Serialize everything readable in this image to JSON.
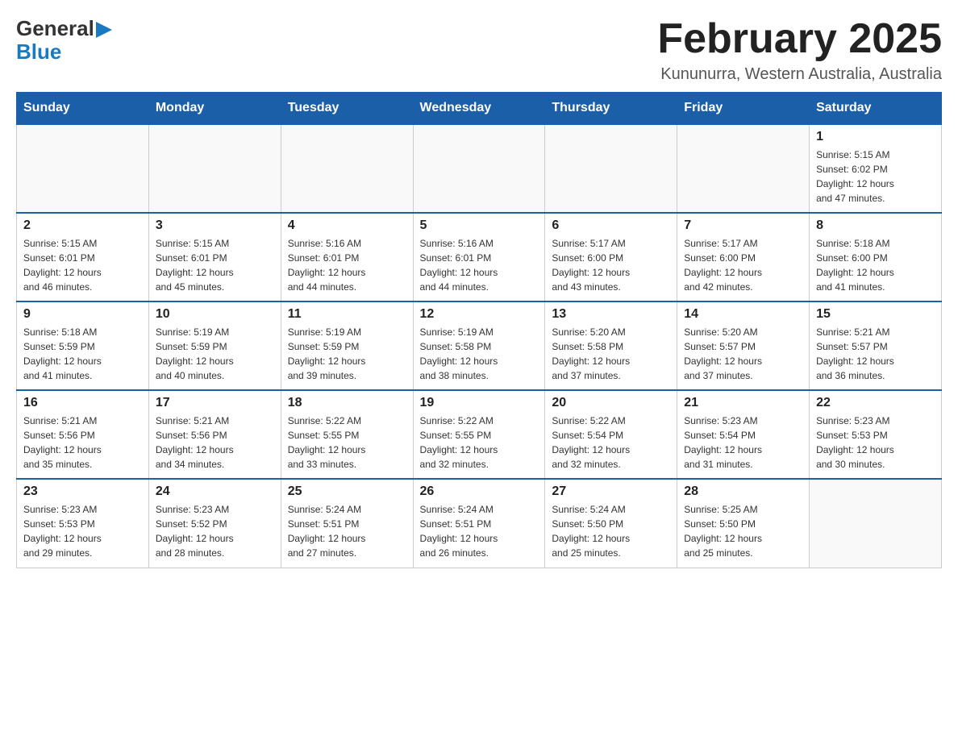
{
  "logo": {
    "line1": "General",
    "arrow": "▶",
    "line2": "Blue"
  },
  "title": "February 2025",
  "location": "Kununurra, Western Australia, Australia",
  "days_of_week": [
    "Sunday",
    "Monday",
    "Tuesday",
    "Wednesday",
    "Thursday",
    "Friday",
    "Saturday"
  ],
  "weeks": [
    [
      {
        "day": "",
        "info": ""
      },
      {
        "day": "",
        "info": ""
      },
      {
        "day": "",
        "info": ""
      },
      {
        "day": "",
        "info": ""
      },
      {
        "day": "",
        "info": ""
      },
      {
        "day": "",
        "info": ""
      },
      {
        "day": "1",
        "info": "Sunrise: 5:15 AM\nSunset: 6:02 PM\nDaylight: 12 hours\nand 47 minutes."
      }
    ],
    [
      {
        "day": "2",
        "info": "Sunrise: 5:15 AM\nSunset: 6:01 PM\nDaylight: 12 hours\nand 46 minutes."
      },
      {
        "day": "3",
        "info": "Sunrise: 5:15 AM\nSunset: 6:01 PM\nDaylight: 12 hours\nand 45 minutes."
      },
      {
        "day": "4",
        "info": "Sunrise: 5:16 AM\nSunset: 6:01 PM\nDaylight: 12 hours\nand 44 minutes."
      },
      {
        "day": "5",
        "info": "Sunrise: 5:16 AM\nSunset: 6:01 PM\nDaylight: 12 hours\nand 44 minutes."
      },
      {
        "day": "6",
        "info": "Sunrise: 5:17 AM\nSunset: 6:00 PM\nDaylight: 12 hours\nand 43 minutes."
      },
      {
        "day": "7",
        "info": "Sunrise: 5:17 AM\nSunset: 6:00 PM\nDaylight: 12 hours\nand 42 minutes."
      },
      {
        "day": "8",
        "info": "Sunrise: 5:18 AM\nSunset: 6:00 PM\nDaylight: 12 hours\nand 41 minutes."
      }
    ],
    [
      {
        "day": "9",
        "info": "Sunrise: 5:18 AM\nSunset: 5:59 PM\nDaylight: 12 hours\nand 41 minutes."
      },
      {
        "day": "10",
        "info": "Sunrise: 5:19 AM\nSunset: 5:59 PM\nDaylight: 12 hours\nand 40 minutes."
      },
      {
        "day": "11",
        "info": "Sunrise: 5:19 AM\nSunset: 5:59 PM\nDaylight: 12 hours\nand 39 minutes."
      },
      {
        "day": "12",
        "info": "Sunrise: 5:19 AM\nSunset: 5:58 PM\nDaylight: 12 hours\nand 38 minutes."
      },
      {
        "day": "13",
        "info": "Sunrise: 5:20 AM\nSunset: 5:58 PM\nDaylight: 12 hours\nand 37 minutes."
      },
      {
        "day": "14",
        "info": "Sunrise: 5:20 AM\nSunset: 5:57 PM\nDaylight: 12 hours\nand 37 minutes."
      },
      {
        "day": "15",
        "info": "Sunrise: 5:21 AM\nSunset: 5:57 PM\nDaylight: 12 hours\nand 36 minutes."
      }
    ],
    [
      {
        "day": "16",
        "info": "Sunrise: 5:21 AM\nSunset: 5:56 PM\nDaylight: 12 hours\nand 35 minutes."
      },
      {
        "day": "17",
        "info": "Sunrise: 5:21 AM\nSunset: 5:56 PM\nDaylight: 12 hours\nand 34 minutes."
      },
      {
        "day": "18",
        "info": "Sunrise: 5:22 AM\nSunset: 5:55 PM\nDaylight: 12 hours\nand 33 minutes."
      },
      {
        "day": "19",
        "info": "Sunrise: 5:22 AM\nSunset: 5:55 PM\nDaylight: 12 hours\nand 32 minutes."
      },
      {
        "day": "20",
        "info": "Sunrise: 5:22 AM\nSunset: 5:54 PM\nDaylight: 12 hours\nand 32 minutes."
      },
      {
        "day": "21",
        "info": "Sunrise: 5:23 AM\nSunset: 5:54 PM\nDaylight: 12 hours\nand 31 minutes."
      },
      {
        "day": "22",
        "info": "Sunrise: 5:23 AM\nSunset: 5:53 PM\nDaylight: 12 hours\nand 30 minutes."
      }
    ],
    [
      {
        "day": "23",
        "info": "Sunrise: 5:23 AM\nSunset: 5:53 PM\nDaylight: 12 hours\nand 29 minutes."
      },
      {
        "day": "24",
        "info": "Sunrise: 5:23 AM\nSunset: 5:52 PM\nDaylight: 12 hours\nand 28 minutes."
      },
      {
        "day": "25",
        "info": "Sunrise: 5:24 AM\nSunset: 5:51 PM\nDaylight: 12 hours\nand 27 minutes."
      },
      {
        "day": "26",
        "info": "Sunrise: 5:24 AM\nSunset: 5:51 PM\nDaylight: 12 hours\nand 26 minutes."
      },
      {
        "day": "27",
        "info": "Sunrise: 5:24 AM\nSunset: 5:50 PM\nDaylight: 12 hours\nand 25 minutes."
      },
      {
        "day": "28",
        "info": "Sunrise: 5:25 AM\nSunset: 5:50 PM\nDaylight: 12 hours\nand 25 minutes."
      },
      {
        "day": "",
        "info": ""
      }
    ]
  ]
}
